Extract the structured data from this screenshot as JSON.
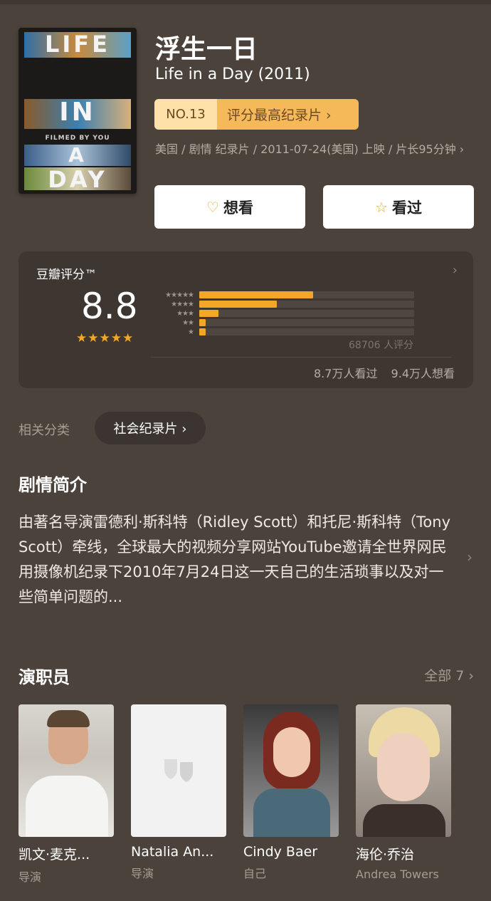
{
  "movie": {
    "title_cn": "浮生一日",
    "title_en": "Life in a Day (2011)",
    "poster": {
      "line1": "LIFE",
      "line2": "IN",
      "line3": "A",
      "line4": "DAY",
      "tagline": "FILMED BY YOU"
    },
    "rank_no": "NO.13",
    "rank_label": "评分最高纪录片 ›",
    "meta": "美国 / 剧情 纪录片 / 2011-07-24(美国) 上映 / 片长95分钟 ›"
  },
  "actions": {
    "want_label": "想看",
    "seen_label": "看过"
  },
  "rating": {
    "header": "豆瓣评分™",
    "score": "8.8",
    "stars_display": "★★★★★",
    "star_rows": [
      "★★★★★",
      "★★★★",
      "★★★",
      "★★",
      "★"
    ],
    "distribution": [
      0.53,
      0.36,
      0.09,
      0.03,
      0.03
    ],
    "count_text": "68706 人评分",
    "seen_text": "8.7万人看过",
    "want_text": "9.4万人想看"
  },
  "category": {
    "label": "相关分类",
    "pill": "社会纪录片 ›"
  },
  "synopsis": {
    "title": "剧情简介",
    "text": "由著名导演雷德利·斯科特（Ridley Scott）和托尼·斯科特（Tony Scott）牵线，全球最大的视频分享网站YouTube邀请全世界网民用摄像机纪录下2010年7月24日这一天自己的生活琐事以及对一些简单问题的..."
  },
  "cast": {
    "title": "演职员",
    "all_label": "全部 7 ›",
    "members": [
      {
        "name": "凯文·麦克...",
        "role": "导演"
      },
      {
        "name": "Natalia An...",
        "role": "导演"
      },
      {
        "name": "Cindy Baer",
        "role": "自己"
      },
      {
        "name": "海伦·乔治",
        "role": "Andrea Towers"
      }
    ]
  },
  "colors": {
    "background": "#4b433b",
    "accent": "#f3a727",
    "card": "#3d3631"
  }
}
